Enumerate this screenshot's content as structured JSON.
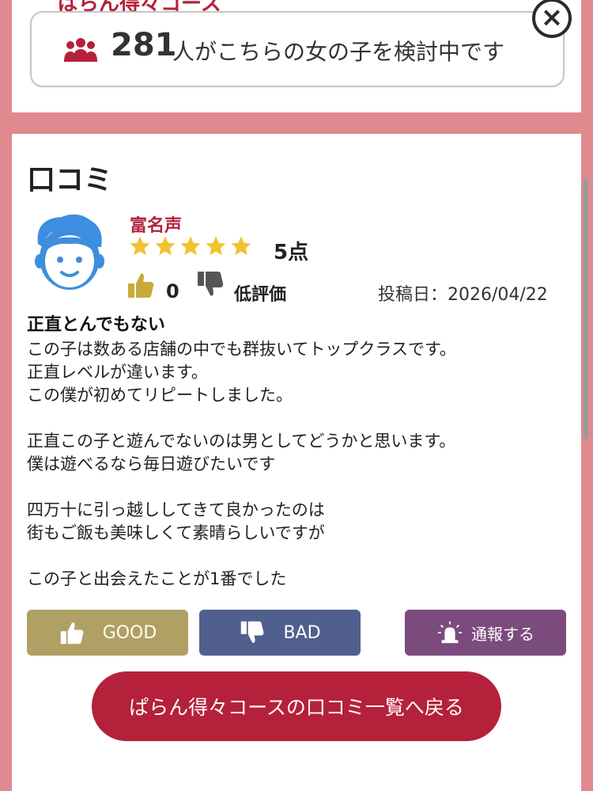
{
  "top": {
    "partial_title": "ぱらん得々コース"
  },
  "popup": {
    "close_label": "×",
    "viewer_count": "281",
    "viewer_text": "人がこちらの女の子を検討中です",
    "icon": "people-group-icon"
  },
  "review_section": {
    "title": "口コミ",
    "reviewer_name": "富名声",
    "star_count": 5,
    "score": "5点",
    "like_count": "0",
    "low_rating_label": "低評価",
    "post_date": "投稿日：2026/04/22",
    "review_title": "正直とんでもない",
    "body_lines": [
      "この子は数ある店舗の中でも群抜いてトップクラスです。",
      "正直レベルが違います。",
      "この僕が初めてリピートしました。",
      "",
      "正直この子と遊んでないのは男としてどうかと思います。",
      "僕は遊べるなら毎日遊びたいです",
      "",
      "四万十に引っ越ししてきて良かったのは",
      "街もご飯も美味しくて素晴らしいですが",
      "",
      "この子と出会えたことが1番でした"
    ]
  },
  "actions": {
    "good_label": "GOOD",
    "bad_label": "BAD",
    "report_label": "通報する",
    "back_label": "ぱらん得々コースの口コミ一覧へ戻る"
  },
  "colors": {
    "page_bg": "#e0898f",
    "accent_red": "#b5213a",
    "good": "#b0a064",
    "bad": "#505f8e",
    "report": "#7c4b7e",
    "star": "#f2c230",
    "avatar_blue": "#3d8ee0"
  }
}
